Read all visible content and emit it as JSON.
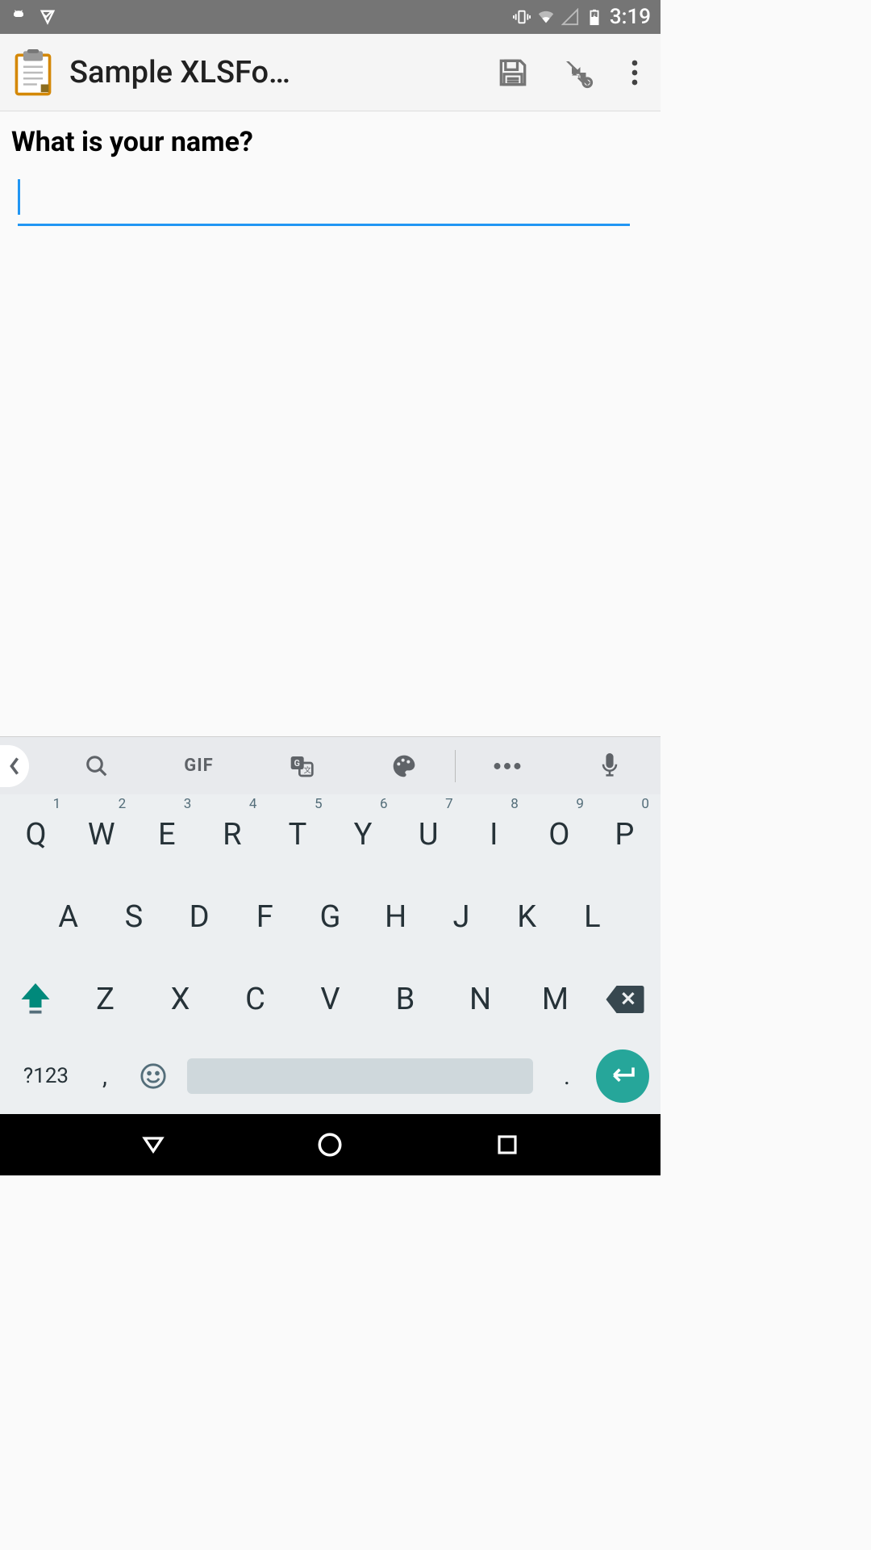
{
  "status": {
    "time": "3:19"
  },
  "appbar": {
    "title": "Sample XLSFo…"
  },
  "content": {
    "question": "What is your name?",
    "input_value": ""
  },
  "keyboard": {
    "suggest": {
      "gif": "GIF"
    },
    "row1": [
      {
        "k": "Q",
        "s": "1"
      },
      {
        "k": "W",
        "s": "2"
      },
      {
        "k": "E",
        "s": "3"
      },
      {
        "k": "R",
        "s": "4"
      },
      {
        "k": "T",
        "s": "5"
      },
      {
        "k": "Y",
        "s": "6"
      },
      {
        "k": "U",
        "s": "7"
      },
      {
        "k": "I",
        "s": "8"
      },
      {
        "k": "O",
        "s": "9"
      },
      {
        "k": "P",
        "s": "0"
      }
    ],
    "row2": [
      "A",
      "S",
      "D",
      "F",
      "G",
      "H",
      "J",
      "K",
      "L"
    ],
    "row3": [
      "Z",
      "X",
      "C",
      "V",
      "B",
      "N",
      "M"
    ],
    "sym": "?123",
    "comma": ",",
    "period": "."
  }
}
